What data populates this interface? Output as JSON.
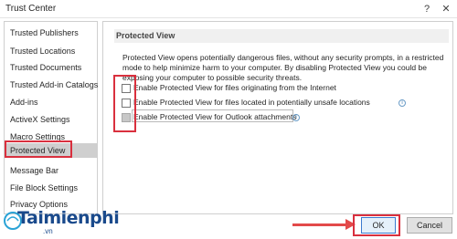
{
  "window": {
    "title": "Trust Center",
    "help_glyph": "?",
    "close_glyph": "✕"
  },
  "sidebar": {
    "items": [
      {
        "label": "Trusted Publishers"
      },
      {
        "label": "Trusted Locations"
      },
      {
        "label": "Trusted Documents"
      },
      {
        "label": "Trusted Add-in Catalogs"
      },
      {
        "label": "Add-ins"
      },
      {
        "label": "ActiveX Settings"
      },
      {
        "label": "Macro Settings"
      },
      {
        "label": "Protected View",
        "selected": true
      },
      {
        "label": "Message Bar"
      },
      {
        "label": "File Block Settings"
      },
      {
        "label": "Privacy Options"
      }
    ]
  },
  "main": {
    "section_title": "Protected View",
    "description_lines": [
      "Protected View opens potentially dangerous files, without any security prompts, in a restricted",
      "mode to help minimize harm to your computer. By disabling Protected View you could be",
      "exposing your computer to possible security threats."
    ],
    "options": [
      {
        "label": "Enable Protected View for files originating from the Internet",
        "checked": false,
        "disabled": false
      },
      {
        "label": "Enable Protected View for files located in potentially unsafe locations",
        "checked": false,
        "disabled": false,
        "info_icon": "info-icon"
      },
      {
        "label": "Enable Protected View for Outlook attachments",
        "checked": false,
        "disabled": true,
        "info_icon": "info-icon"
      }
    ],
    "info_glyph": "i"
  },
  "buttons": {
    "ok_label": "OK",
    "cancel_label": "Cancel"
  },
  "watermark": {
    "logo_text": "Taimienphi",
    "logo_sub": ".vn"
  },
  "colors": {
    "highlight_red": "#d9303e",
    "selected_item": "#cfcfcf",
    "ok_border": "#3b7bcf"
  }
}
